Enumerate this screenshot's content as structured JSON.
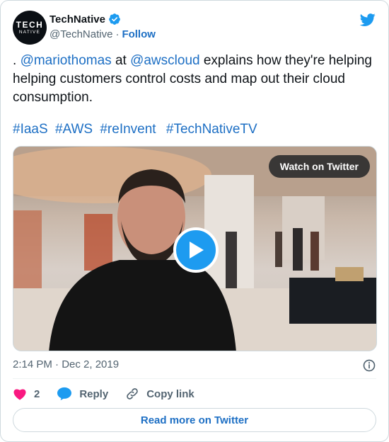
{
  "author": {
    "avatar_line1": "TECH",
    "avatar_line2": "NATIVE",
    "display_name": "TechNative",
    "handle": "@TechNative",
    "separator": "·",
    "follow_label": "Follow"
  },
  "tweet": {
    "prefix": ". ",
    "mention1": "@mariothomas",
    "mid1": " at ",
    "mention2": "@awscloud",
    "rest": " explains how they're helping helping customers control costs and map out their cloud consumption.",
    "hashtags": [
      "#IaaS",
      "#AWS",
      "#reInvent",
      "#TechNativeTV"
    ]
  },
  "media": {
    "watch_label": "Watch on Twitter"
  },
  "meta": {
    "timestamp": "2:14 PM · Dec 2, 2019"
  },
  "actions": {
    "likes_count": "2",
    "reply_label": "Reply",
    "copy_label": "Copy link"
  },
  "footer": {
    "read_more_label": "Read more on Twitter"
  },
  "colors": {
    "link": "#1d6fc4",
    "twitter_blue": "#1d9bf0",
    "heart": "#f91880",
    "muted": "#536471"
  }
}
